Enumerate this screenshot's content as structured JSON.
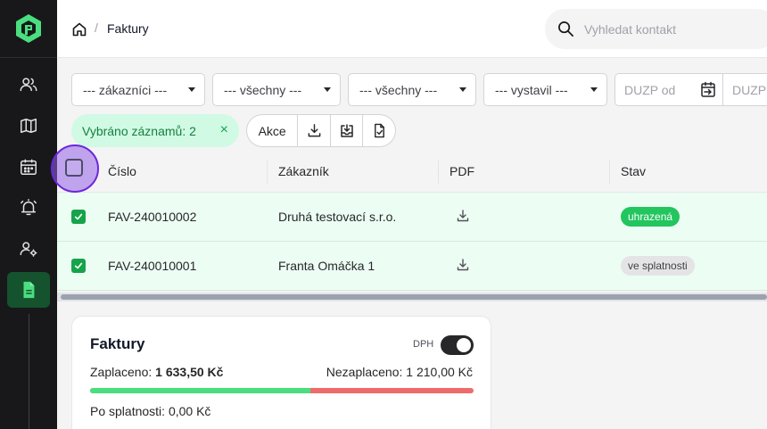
{
  "header": {
    "breadcrumb_current": "Faktury",
    "breadcrumb_separator": "/",
    "search_placeholder": "Vyhledat kontakt"
  },
  "sidebar": {
    "items": [
      {
        "icon": "users-icon",
        "active": false
      },
      {
        "icon": "map-icon",
        "active": false
      },
      {
        "icon": "calendar-icon",
        "active": false
      },
      {
        "icon": "alarm-bell-icon",
        "active": false
      },
      {
        "icon": "user-settings-icon",
        "active": false
      },
      {
        "icon": "document-icon",
        "active": true
      }
    ]
  },
  "filters": {
    "customers": "--- zákazníci ---",
    "filter_two": "--- všechny ---",
    "filter_three": "--- všechny ---",
    "issued_by": "--- vystavil ---",
    "duzp_from_placeholder": "DUZP od",
    "duzp_to_placeholder": "DUZP"
  },
  "selection": {
    "label": "Vybráno záznamů: 2",
    "close": "×",
    "actions_label": "Akce"
  },
  "table": {
    "columns": [
      "Číslo",
      "Zákazník",
      "PDF",
      "Stav"
    ],
    "rows": [
      {
        "number": "FAV-240010002",
        "customer": "Druhá testovací s.r.o.",
        "status": "uhrazená",
        "status_type": "paid",
        "checked": true
      },
      {
        "number": "FAV-240010001",
        "customer": "Franta Omáčka 1",
        "status": "ve splatnosti",
        "status_type": "due",
        "checked": true
      }
    ]
  },
  "summary": {
    "title": "Faktury",
    "dph_label": "DPH",
    "dph_on": true,
    "paid_label": "Zaplaceno:",
    "paid_value": "1 633,50 Kč",
    "unpaid_text": "Nezaplaceno: 1 210,00 Kč",
    "overdue_text": "Po splatnosti: 0,00 Kč",
    "paid_fraction": 0.574
  },
  "colors": {
    "brand": "#4ade80",
    "paid": "#22c55e",
    "unpaid": "#ef6b6b",
    "highlight": "#9660e6"
  }
}
